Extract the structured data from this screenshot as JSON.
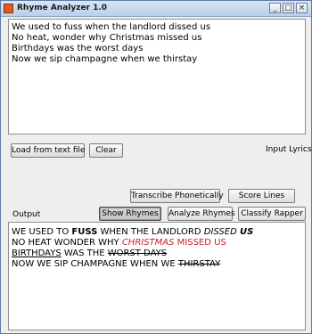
{
  "window": {
    "title": "Rhyme Analyzer 1.0",
    "controls": {
      "minimize": "_",
      "maximize": "□",
      "close": "×"
    }
  },
  "input": {
    "label": "Input Lyrics",
    "lines": [
      "We used to fuss when the landlord dissed us",
      "No heat, wonder why Christmas missed us",
      "Birthdays was the worst days",
      "Now we sip champagne when we thirstay"
    ]
  },
  "buttons": {
    "load": "Load from text file",
    "clear": "Clear",
    "transcribe": "Transcribe Phonetically",
    "score": "Score Lines",
    "show_rhymes": "Show Rhymes",
    "analyze": "Analyze Rhymes",
    "classify": "Classify Rapper"
  },
  "output": {
    "label": "Output",
    "lines": [
      [
        {
          "text": "WE USED TO ",
          "style": "plain"
        },
        {
          "text": "FUSS",
          "style": "bold"
        },
        {
          "text": " WHEN THE LANDLORD ",
          "style": "plain"
        },
        {
          "text": "DISSED",
          "style": "italic"
        },
        {
          "text": " ",
          "style": "plain"
        },
        {
          "text": "US",
          "style": "bold-italic"
        }
      ],
      [
        {
          "text": "NO HEAT WONDER WHY ",
          "style": "plain"
        },
        {
          "text": "CHRISTMAS",
          "style": "red-italic"
        },
        {
          "text": " MISSED US",
          "style": "red"
        }
      ],
      [
        {
          "text": "BIRTHDAYS",
          "style": "underline"
        },
        {
          "text": " WAS THE ",
          "style": "plain"
        },
        {
          "text": "WORST DAYS",
          "style": "underline-strike"
        }
      ],
      [
        {
          "text": "NOW WE SIP CHAMPAGNE WHEN WE ",
          "style": "plain"
        },
        {
          "text": "THIRSTAY",
          "style": "strike"
        }
      ]
    ]
  }
}
